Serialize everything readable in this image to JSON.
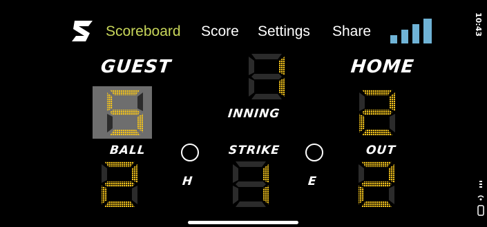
{
  "nav": {
    "active": "Scoreboard",
    "scoreboard_label": "Scoreboard",
    "score_label": "Score",
    "settings_label": "Settings",
    "share_label": "Share"
  },
  "labels": {
    "guest": "GUEST",
    "home": "HOME",
    "inning": "INNING",
    "ball": "BALL",
    "strike": "STRIKE",
    "out": "OUT",
    "hit": "H",
    "error": "E"
  },
  "values": {
    "guest_score": "5",
    "home_score": "2",
    "inning": "1",
    "ball": "2",
    "strike": "1",
    "out": "2"
  },
  "status": {
    "time": "10:43"
  },
  "colors": {
    "accent_nav": "#c8d65a",
    "digit_on": "#f2c21d",
    "digit_off": "#2b2b2b",
    "signal": "#6fb3d6"
  }
}
